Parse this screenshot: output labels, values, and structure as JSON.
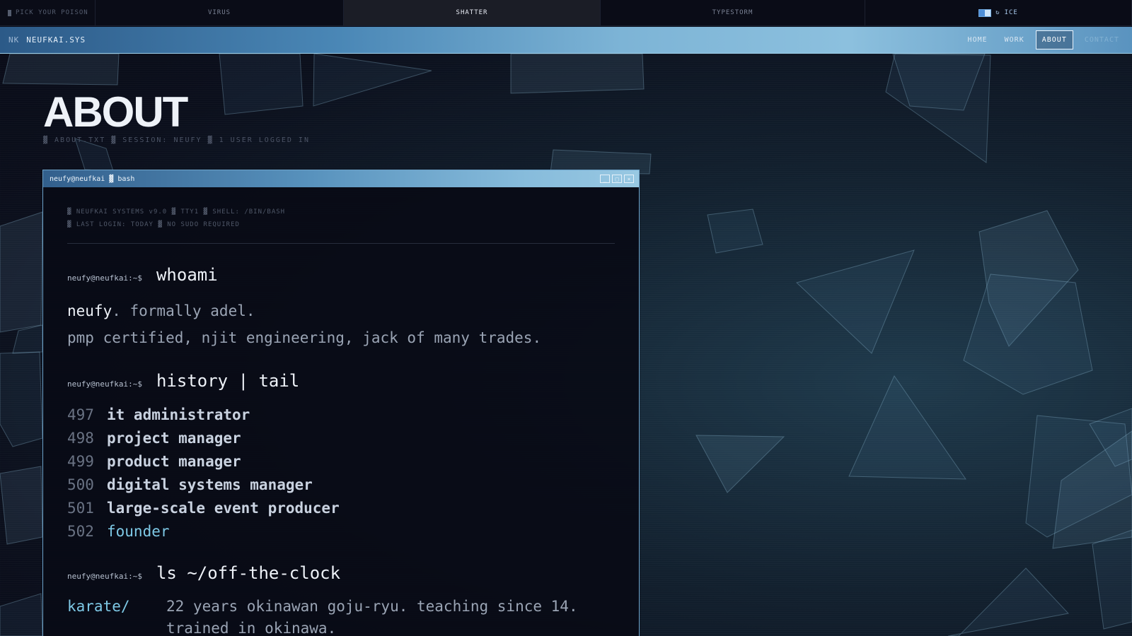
{
  "theme_bar": {
    "pick_label": "PICK YOUR POISON",
    "tabs": [
      {
        "label": "VIRUS"
      },
      {
        "label": "SHATTER"
      },
      {
        "label": "TYPESTORM"
      }
    ],
    "active": "SHATTER",
    "ice": {
      "symbol": "↻",
      "label": "ICE"
    }
  },
  "nav": {
    "brand_mark": "NK",
    "brand_name": "NEUFKAI.SYS",
    "links": [
      "HOME",
      "WORK",
      "ABOUT",
      "CONTACT"
    ],
    "active": "ABOUT"
  },
  "page": {
    "title": "ABOUT",
    "meta": "▓ ABOUT.TXT ▓ SESSION: NEUFY ▓ 1 USER LOGGED IN"
  },
  "terminal": {
    "title": "neufy@neufkai ▓ bash",
    "controls": [
      "_",
      "□",
      "×"
    ],
    "sysinfo": [
      "▓ NEUFKAI SYSTEMS v9.0 ▓ TTY1 ▓ SHELL: /BIN/BASH",
      "▓ LAST LOGIN: TODAY ▓ NO SUDO REQUIRED"
    ],
    "prompt": "neufy@neufkai:~$",
    "whoami": {
      "command": "whoami",
      "name": "neufy",
      "name_rest": ". formally adel.",
      "line2": "pmp certified, njit engineering, jack of many trades."
    },
    "history": {
      "command": "history | tail",
      "items": [
        {
          "num": "497",
          "role": "it administrator"
        },
        {
          "num": "498",
          "role": "project manager"
        },
        {
          "num": "499",
          "role": "product manager"
        },
        {
          "num": "500",
          "role": "digital systems manager"
        },
        {
          "num": "501",
          "role": "large-scale event producer"
        },
        {
          "num": "502",
          "role": "founder"
        }
      ]
    },
    "ls": {
      "command": "ls ~/off-the-clock",
      "entries": [
        {
          "dir": "karate/",
          "desc": "22 years okinawan goju-ryu. teaching since 14.",
          "desc2": "trained in okinawa."
        }
      ]
    }
  },
  "colors": {
    "accent": "#7ec9e6",
    "nav_gradient_start": "#2c5a88",
    "nav_gradient_end": "#8cc0de",
    "background": "#090b17"
  }
}
